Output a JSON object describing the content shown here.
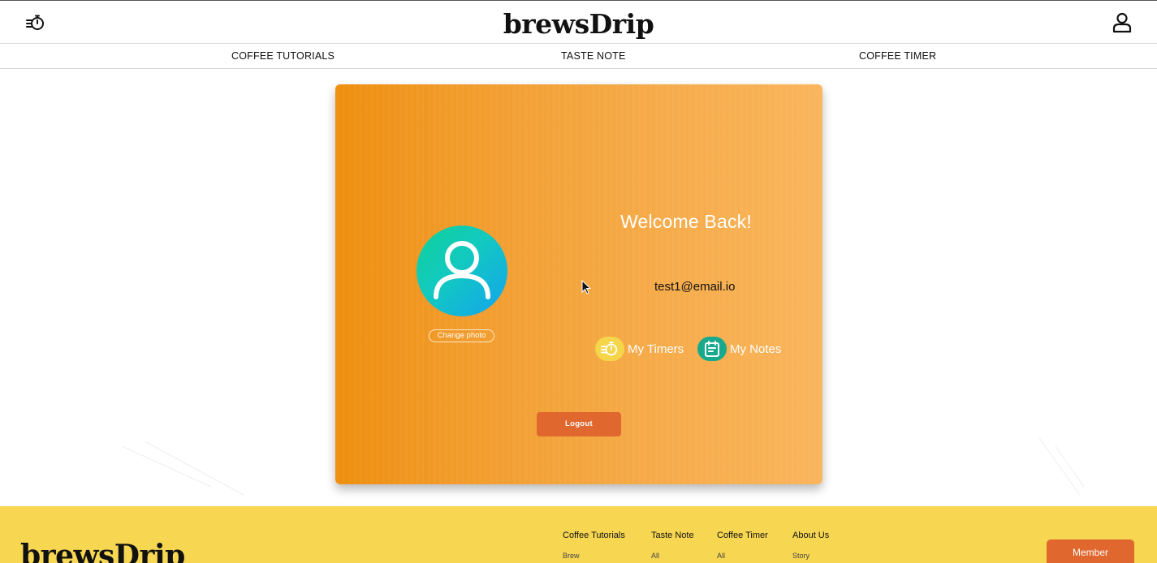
{
  "header": {
    "brand": "brewsDrip",
    "timer_icon": "stopwatch-icon",
    "user_icon": "user-icon"
  },
  "nav": {
    "items": [
      {
        "label": "COFFEE TUTORIALS"
      },
      {
        "label": "TASTE NOTE"
      },
      {
        "label": "COFFEE TIMER"
      }
    ]
  },
  "profile": {
    "avatar_icon": "user-avatar-icon",
    "change_photo_label": "Change photo",
    "welcome": "Welcome Back!",
    "email": "test1@email.io",
    "my_timers_label": "My Timers",
    "my_timers_icon": "stopwatch-icon",
    "my_notes_label": "My Notes",
    "my_notes_icon": "notepad-icon",
    "logout_label": "Logout"
  },
  "footer": {
    "brand": "brewsDrip",
    "columns": [
      {
        "heading": "Coffee Tutorials",
        "link": "Brew"
      },
      {
        "heading": "Taste Note",
        "link": "All"
      },
      {
        "heading": "Coffee Timer",
        "link": "All"
      },
      {
        "heading": "About Us",
        "link": "Story"
      }
    ],
    "member_label": "Member"
  },
  "colors": {
    "card_start": "#ee8d0b",
    "card_end": "#fab45a",
    "accent_button": "#e0672e",
    "footer_bg": "#f7d652",
    "avatar_teal": "#0fd19a",
    "avatar_blue": "#14a3f0",
    "timers_icon_bg": "#f5d54a",
    "notes_icon_bg": "#17a98b"
  }
}
